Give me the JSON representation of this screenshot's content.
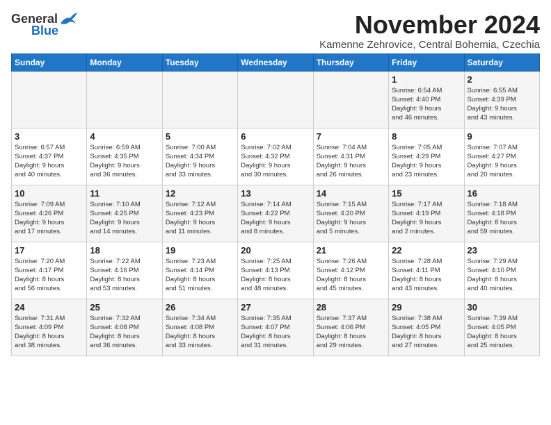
{
  "logo": {
    "general": "General",
    "blue": "Blue"
  },
  "title": "November 2024",
  "location": "Kamenne Zehrovice, Central Bohemia, Czechia",
  "headers": [
    "Sunday",
    "Monday",
    "Tuesday",
    "Wednesday",
    "Thursday",
    "Friday",
    "Saturday"
  ],
  "rows": [
    [
      {
        "day": "",
        "detail": ""
      },
      {
        "day": "",
        "detail": ""
      },
      {
        "day": "",
        "detail": ""
      },
      {
        "day": "",
        "detail": ""
      },
      {
        "day": "",
        "detail": ""
      },
      {
        "day": "1",
        "detail": "Sunrise: 6:54 AM\nSunset: 4:40 PM\nDaylight: 9 hours\nand 46 minutes."
      },
      {
        "day": "2",
        "detail": "Sunrise: 6:55 AM\nSunset: 4:39 PM\nDaylight: 9 hours\nand 43 minutes."
      }
    ],
    [
      {
        "day": "3",
        "detail": "Sunrise: 6:57 AM\nSunset: 4:37 PM\nDaylight: 9 hours\nand 40 minutes."
      },
      {
        "day": "4",
        "detail": "Sunrise: 6:59 AM\nSunset: 4:35 PM\nDaylight: 9 hours\nand 36 minutes."
      },
      {
        "day": "5",
        "detail": "Sunrise: 7:00 AM\nSunset: 4:34 PM\nDaylight: 9 hours\nand 33 minutes."
      },
      {
        "day": "6",
        "detail": "Sunrise: 7:02 AM\nSunset: 4:32 PM\nDaylight: 9 hours\nand 30 minutes."
      },
      {
        "day": "7",
        "detail": "Sunrise: 7:04 AM\nSunset: 4:31 PM\nDaylight: 9 hours\nand 26 minutes."
      },
      {
        "day": "8",
        "detail": "Sunrise: 7:05 AM\nSunset: 4:29 PM\nDaylight: 9 hours\nand 23 minutes."
      },
      {
        "day": "9",
        "detail": "Sunrise: 7:07 AM\nSunset: 4:27 PM\nDaylight: 9 hours\nand 20 minutes."
      }
    ],
    [
      {
        "day": "10",
        "detail": "Sunrise: 7:09 AM\nSunset: 4:26 PM\nDaylight: 9 hours\nand 17 minutes."
      },
      {
        "day": "11",
        "detail": "Sunrise: 7:10 AM\nSunset: 4:25 PM\nDaylight: 9 hours\nand 14 minutes."
      },
      {
        "day": "12",
        "detail": "Sunrise: 7:12 AM\nSunset: 4:23 PM\nDaylight: 9 hours\nand 11 minutes."
      },
      {
        "day": "13",
        "detail": "Sunrise: 7:14 AM\nSunset: 4:22 PM\nDaylight: 9 hours\nand 8 minutes."
      },
      {
        "day": "14",
        "detail": "Sunrise: 7:15 AM\nSunset: 4:20 PM\nDaylight: 9 hours\nand 5 minutes."
      },
      {
        "day": "15",
        "detail": "Sunrise: 7:17 AM\nSunset: 4:19 PM\nDaylight: 9 hours\nand 2 minutes."
      },
      {
        "day": "16",
        "detail": "Sunrise: 7:18 AM\nSunset: 4:18 PM\nDaylight: 8 hours\nand 59 minutes."
      }
    ],
    [
      {
        "day": "17",
        "detail": "Sunrise: 7:20 AM\nSunset: 4:17 PM\nDaylight: 8 hours\nand 56 minutes."
      },
      {
        "day": "18",
        "detail": "Sunrise: 7:22 AM\nSunset: 4:16 PM\nDaylight: 8 hours\nand 53 minutes."
      },
      {
        "day": "19",
        "detail": "Sunrise: 7:23 AM\nSunset: 4:14 PM\nDaylight: 8 hours\nand 51 minutes."
      },
      {
        "day": "20",
        "detail": "Sunrise: 7:25 AM\nSunset: 4:13 PM\nDaylight: 8 hours\nand 48 minutes."
      },
      {
        "day": "21",
        "detail": "Sunrise: 7:26 AM\nSunset: 4:12 PM\nDaylight: 8 hours\nand 45 minutes."
      },
      {
        "day": "22",
        "detail": "Sunrise: 7:28 AM\nSunset: 4:11 PM\nDaylight: 8 hours\nand 43 minutes."
      },
      {
        "day": "23",
        "detail": "Sunrise: 7:29 AM\nSunset: 4:10 PM\nDaylight: 8 hours\nand 40 minutes."
      }
    ],
    [
      {
        "day": "24",
        "detail": "Sunrise: 7:31 AM\nSunset: 4:09 PM\nDaylight: 8 hours\nand 38 minutes."
      },
      {
        "day": "25",
        "detail": "Sunrise: 7:32 AM\nSunset: 4:08 PM\nDaylight: 8 hours\nand 36 minutes."
      },
      {
        "day": "26",
        "detail": "Sunrise: 7:34 AM\nSunset: 4:08 PM\nDaylight: 8 hours\nand 33 minutes."
      },
      {
        "day": "27",
        "detail": "Sunrise: 7:35 AM\nSunset: 4:07 PM\nDaylight: 8 hours\nand 31 minutes."
      },
      {
        "day": "28",
        "detail": "Sunrise: 7:37 AM\nSunset: 4:06 PM\nDaylight: 8 hours\nand 29 minutes."
      },
      {
        "day": "29",
        "detail": "Sunrise: 7:38 AM\nSunset: 4:05 PM\nDaylight: 8 hours\nand 27 minutes."
      },
      {
        "day": "30",
        "detail": "Sunrise: 7:39 AM\nSunset: 4:05 PM\nDaylight: 8 hours\nand 25 minutes."
      }
    ]
  ]
}
